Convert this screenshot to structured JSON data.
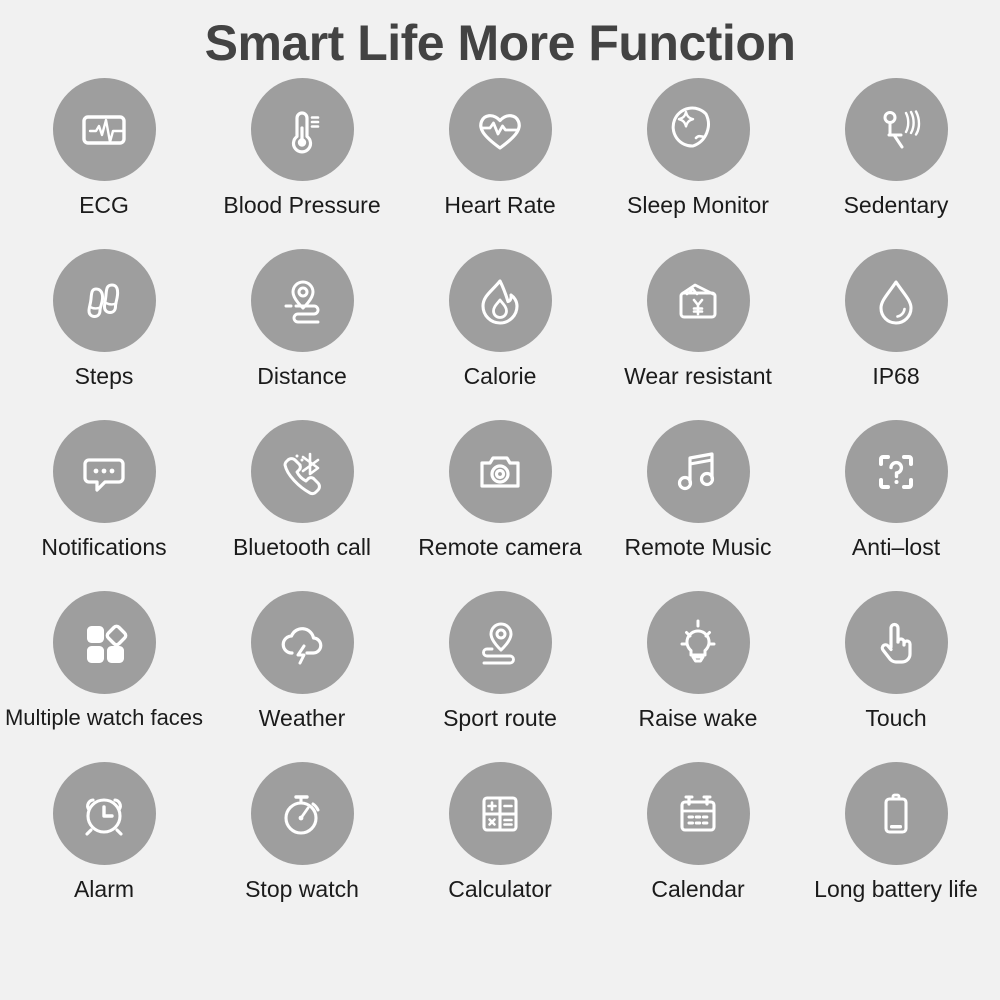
{
  "header": {
    "title": "Smart Life More Function"
  },
  "colors": {
    "background": "#f1f1f1",
    "circle_fill": "#9e9e9e",
    "icon_stroke": "#ffffff",
    "title_text": "#434343",
    "label_text": "#1b1b1b"
  },
  "features": {
    "rows": [
      [
        {
          "label": "ECG",
          "icon": "ecg-icon"
        },
        {
          "label": "Blood Pressure",
          "icon": "thermometer-icon"
        },
        {
          "label": "Heart Rate",
          "icon": "heart-pulse-icon"
        },
        {
          "label": "Sleep Monitor",
          "icon": "moon-star-icon"
        },
        {
          "label": "Sedentary",
          "icon": "seated-person-vibrate-icon"
        }
      ],
      [
        {
          "label": "Steps",
          "icon": "footprints-icon"
        },
        {
          "label": "Distance",
          "icon": "map-pin-route-icon"
        },
        {
          "label": "Calorie",
          "icon": "flame-icon"
        },
        {
          "label": "Wear resistant",
          "icon": "wallet-yen-icon"
        },
        {
          "label": "IP68",
          "icon": "water-drop-icon"
        }
      ],
      [
        {
          "label": "Notifications",
          "icon": "chat-bubble-dots-icon"
        },
        {
          "label": "Bluetooth call",
          "icon": "bluetooth-phone-icon"
        },
        {
          "label": "Remote camera",
          "icon": "camera-icon"
        },
        {
          "label": "Remote Music",
          "icon": "music-note-icon"
        },
        {
          "label": "Anti–lost",
          "icon": "question-bracket-icon"
        }
      ],
      [
        {
          "label": "Multiple watch faces",
          "icon": "watch-faces-grid-icon"
        },
        {
          "label": "Weather",
          "icon": "cloud-lightning-icon"
        },
        {
          "label": "Sport route",
          "icon": "pin-path-icon"
        },
        {
          "label": "Raise wake",
          "icon": "lightbulb-icon"
        },
        {
          "label": "Touch",
          "icon": "pointing-hand-icon"
        }
      ],
      [
        {
          "label": "Alarm",
          "icon": "alarm-clock-icon"
        },
        {
          "label": "Stop watch",
          "icon": "stopwatch-icon"
        },
        {
          "label": "Calculator",
          "icon": "calculator-icon"
        },
        {
          "label": "Calendar",
          "icon": "calendar-icon"
        },
        {
          "label": "Long battery life",
          "icon": "battery-icon"
        }
      ]
    ]
  }
}
